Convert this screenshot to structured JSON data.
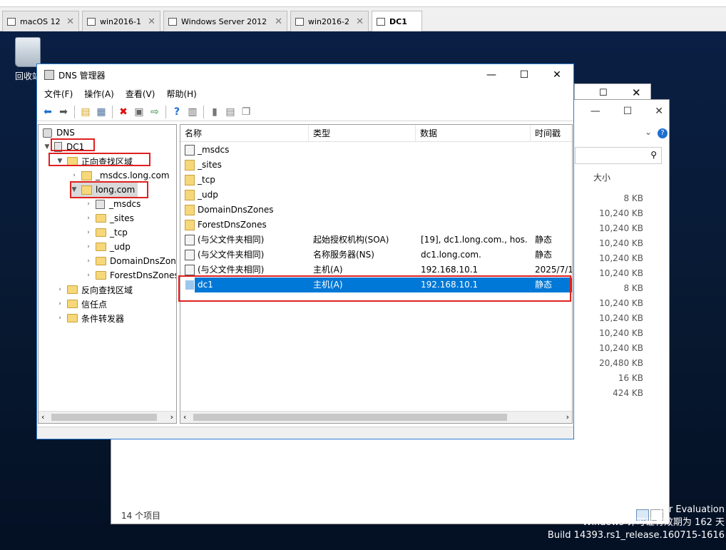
{
  "tabs": [
    {
      "label": "macOS 12",
      "active": false
    },
    {
      "label": "win2016-1",
      "active": false
    },
    {
      "label": "Windows Server 2012",
      "active": false
    },
    {
      "label": "win2016-2",
      "active": false
    },
    {
      "label": "DC1",
      "active": true
    }
  ],
  "desktop": {
    "recycle_label": "回收站",
    "watermark_line1": "ter Evaluation",
    "watermark_line2": "Windows 许可证有效期为 162 天",
    "watermark_line3": "Build 14393.rs1_release.160715-1616"
  },
  "explorer": {
    "size_header": "大小",
    "sizes": [
      "8 KB",
      "10,240 KB",
      "10,240 KB",
      "10,240 KB",
      "10,240 KB",
      "10,240 KB",
      "8 KB",
      "10,240 KB",
      "10,240 KB",
      "10,240 KB",
      "10,240 KB",
      "20,480 KB",
      "16 KB",
      "424 KB"
    ],
    "status": "14 个项目"
  },
  "dns_window": {
    "title": "DNS 管理器",
    "menu": [
      "文件(F)",
      "操作(A)",
      "查看(V)",
      "帮助(H)"
    ],
    "tree": {
      "root": "DNS",
      "server": "DC1",
      "forward_zone": "正向查找区域",
      "msdcs_zone": "_msdcs.long.com",
      "long_zone": "long.com",
      "long_children": [
        "_msdcs",
        "_sites",
        "_tcp",
        "_udp",
        "DomainDnsZones",
        "ForestDnsZones"
      ],
      "reverse_zone": "反向查找区域",
      "trust_points": "信任点",
      "conditional_forwarders": "条件转发器"
    },
    "columns": [
      "名称",
      "类型",
      "数据",
      "时间戳"
    ],
    "rows": [
      {
        "name": "_msdcs",
        "type": "",
        "data": "",
        "timestamp": "",
        "icon": "rec"
      },
      {
        "name": "_sites",
        "type": "",
        "data": "",
        "timestamp": "",
        "icon": "folder"
      },
      {
        "name": "_tcp",
        "type": "",
        "data": "",
        "timestamp": "",
        "icon": "folder"
      },
      {
        "name": "_udp",
        "type": "",
        "data": "",
        "timestamp": "",
        "icon": "folder"
      },
      {
        "name": "DomainDnsZones",
        "type": "",
        "data": "",
        "timestamp": "",
        "icon": "folder"
      },
      {
        "name": "ForestDnsZones",
        "type": "",
        "data": "",
        "timestamp": "",
        "icon": "folder"
      },
      {
        "name": "(与父文件夹相同)",
        "type": "起始授权机构(SOA)",
        "data": "[19], dc1.long.com., hos...",
        "timestamp": "静态",
        "icon": "rec"
      },
      {
        "name": "(与父文件夹相同)",
        "type": "名称服务器(NS)",
        "data": "dc1.long.com.",
        "timestamp": "静态",
        "icon": "rec"
      },
      {
        "name": "(与父文件夹相同)",
        "type": "主机(A)",
        "data": "192.168.10.1",
        "timestamp": "2025/7/1",
        "icon": "rec"
      },
      {
        "name": "dc1",
        "type": "主机(A)",
        "data": "192.168.10.1",
        "timestamp": "静态",
        "icon": "recsel",
        "selected": true
      }
    ]
  }
}
